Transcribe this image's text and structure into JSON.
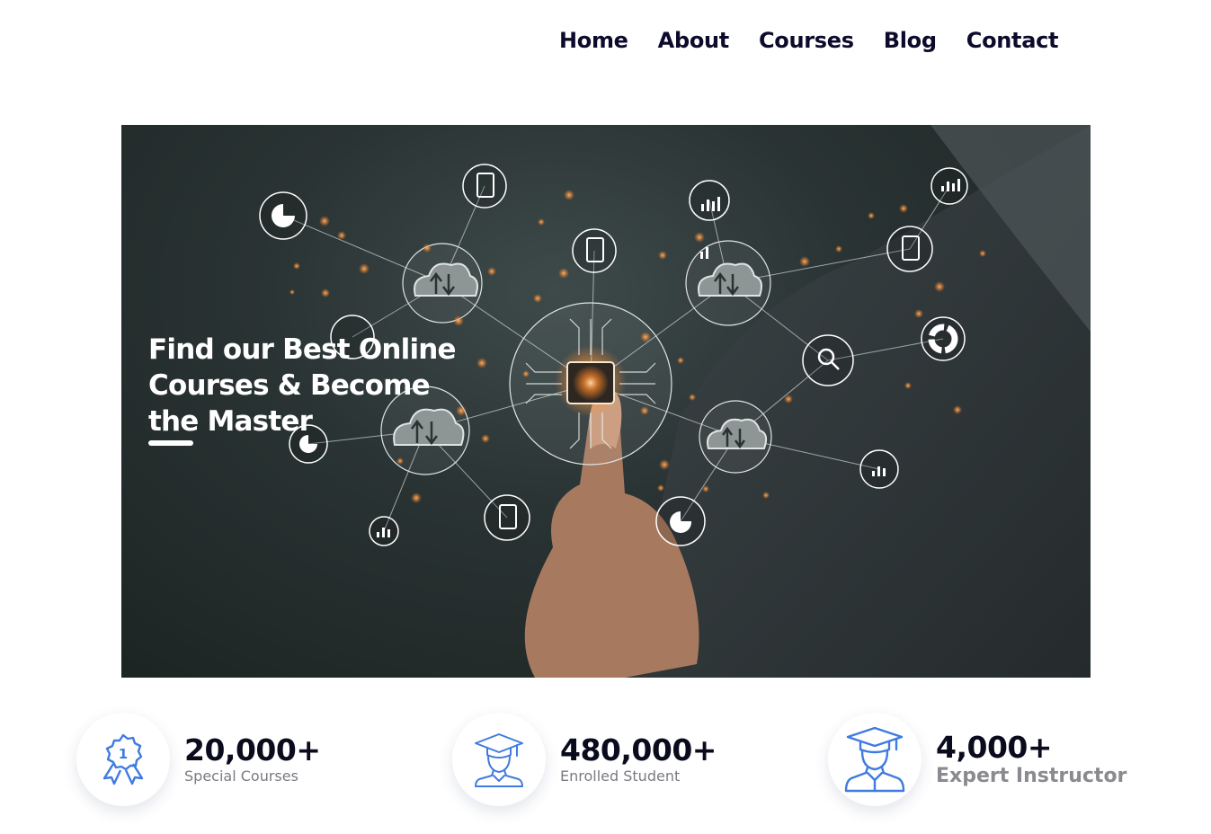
{
  "nav": {
    "items": [
      {
        "label": "Home"
      },
      {
        "label": "About"
      },
      {
        "label": "Courses"
      },
      {
        "label": "Blog"
      },
      {
        "label": "Contact"
      }
    ]
  },
  "hero": {
    "title": "Find our Best Online Courses & Become the Master",
    "image_icons": [
      "cloud-sync-icon",
      "chip-icon",
      "pie-chart-icon",
      "bar-chart-icon",
      "report-icon",
      "magnifier-icon",
      "donut-chart-icon"
    ]
  },
  "stats": [
    {
      "value": "20,000+",
      "label": "Special Courses",
      "icon": "award-ribbon-icon"
    },
    {
      "value": "480,000+",
      "label": "Enrolled Student",
      "icon": "student-icon"
    },
    {
      "value": "4,000+",
      "label": "Expert Instructor",
      "icon": "graduate-icon"
    }
  ],
  "colors": {
    "text_dark": "#0d0b2b",
    "accent_blue": "#3f7be0",
    "label_gray": "#7a7a82",
    "glow_orange": "#ff8a2a"
  }
}
